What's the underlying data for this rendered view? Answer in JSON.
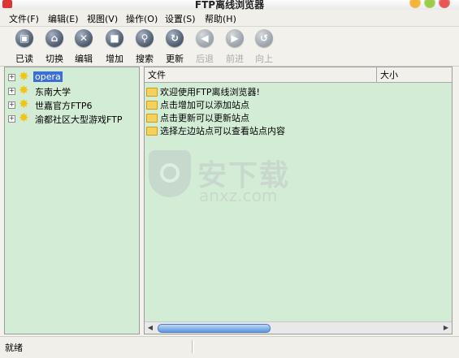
{
  "window": {
    "title": "FTP离线浏览器"
  },
  "menu": [
    {
      "label": "文件(F)"
    },
    {
      "label": "编辑(E)"
    },
    {
      "label": "视图(V)"
    },
    {
      "label": "操作(O)"
    },
    {
      "label": "设置(S)"
    },
    {
      "label": "帮助(H)"
    }
  ],
  "toolbar": [
    {
      "label": "已读",
      "icon": "read-icon",
      "glyph": "▣",
      "enabled": true
    },
    {
      "label": "切换",
      "icon": "home-icon",
      "glyph": "⌂",
      "enabled": true
    },
    {
      "label": "编辑",
      "icon": "edit-icon",
      "glyph": "✕",
      "enabled": true
    },
    {
      "label": "增加",
      "icon": "add-icon",
      "glyph": "■",
      "enabled": true
    },
    {
      "label": "搜索",
      "icon": "search-icon",
      "glyph": "⚲",
      "enabled": true
    },
    {
      "label": "更新",
      "icon": "refresh-icon",
      "glyph": "↻",
      "enabled": true
    },
    {
      "label": "后退",
      "icon": "back-icon",
      "glyph": "◀",
      "enabled": false
    },
    {
      "label": "前进",
      "icon": "forward-icon",
      "glyph": "▶",
      "enabled": false
    },
    {
      "label": "向上",
      "icon": "up-icon",
      "glyph": "↺",
      "enabled": false
    }
  ],
  "tree": [
    {
      "label": "opera",
      "selected": true
    },
    {
      "label": "东南大学",
      "selected": false
    },
    {
      "label": "世嘉官方FTP6",
      "selected": false
    },
    {
      "label": "渝都社区大型游戏FTP",
      "selected": false
    }
  ],
  "file_list": {
    "columns": [
      "文件",
      "大小"
    ],
    "rows": [
      "欢迎使用FTP离线浏览器!",
      "点击增加可以添加站点",
      "点击更新可以更新站点",
      "选择左边站点可以查看站点内容"
    ]
  },
  "watermark": {
    "title": "安下载",
    "domain": "anxz.com"
  },
  "status": {
    "text": "就绪"
  },
  "colors": {
    "panel_bg": "#d3ecd5",
    "selection": "#3a6fd8"
  }
}
